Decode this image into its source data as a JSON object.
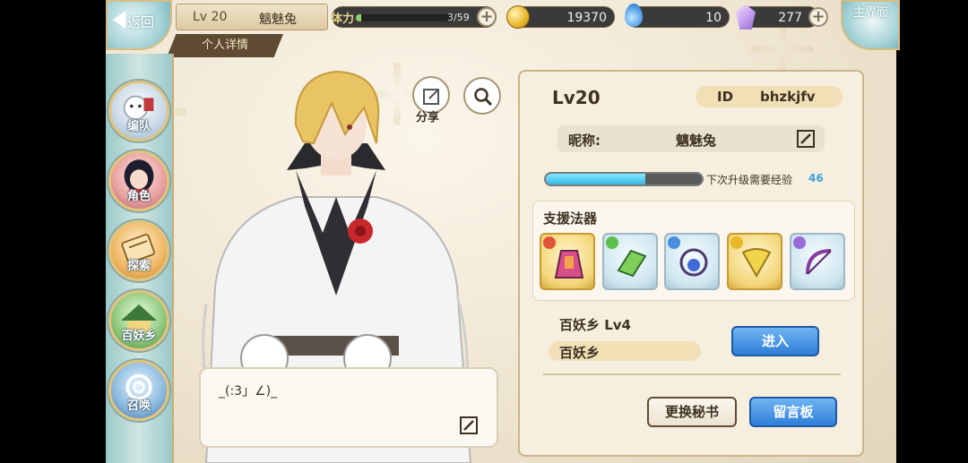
{
  "topbar": {
    "back_label": "返回",
    "level": "Lv 20",
    "player_name": "魑魅兔",
    "tab_label": "个人详情",
    "stamina_label": "体力",
    "stamina_value": "3/59",
    "stamina_fraction": 0.05,
    "coins": "19370",
    "drops": "10",
    "gems": "277",
    "home_label": "主界面"
  },
  "nav": {
    "items": [
      {
        "label": "编队"
      },
      {
        "label": "角色"
      },
      {
        "label": "探索"
      },
      {
        "label": "百妖乡"
      },
      {
        "label": "召唤"
      }
    ]
  },
  "actions": {
    "share_label": "分享"
  },
  "bubble": {
    "text": "_(:3」∠)_"
  },
  "profile": {
    "level": "Lv20",
    "id_label": "ID",
    "id_value": "bhzkjfv",
    "nickname_label": "昵称:",
    "nickname_value": "魑魅兔",
    "exp_fraction": 0.64,
    "exp_label": "下次升级需要经验",
    "exp_value": "46",
    "support_title": "支援法器",
    "village_line": "百妖乡  Lv4",
    "village_name": "百妖乡",
    "enter_label": "进入",
    "change_secretary_label": "更换秘书",
    "message_board_label": "留言板"
  },
  "colors": {
    "accent_blue": "#2f7fd8",
    "panel_bg": "#f6efe0",
    "gold_frame": "#d7bd83"
  }
}
